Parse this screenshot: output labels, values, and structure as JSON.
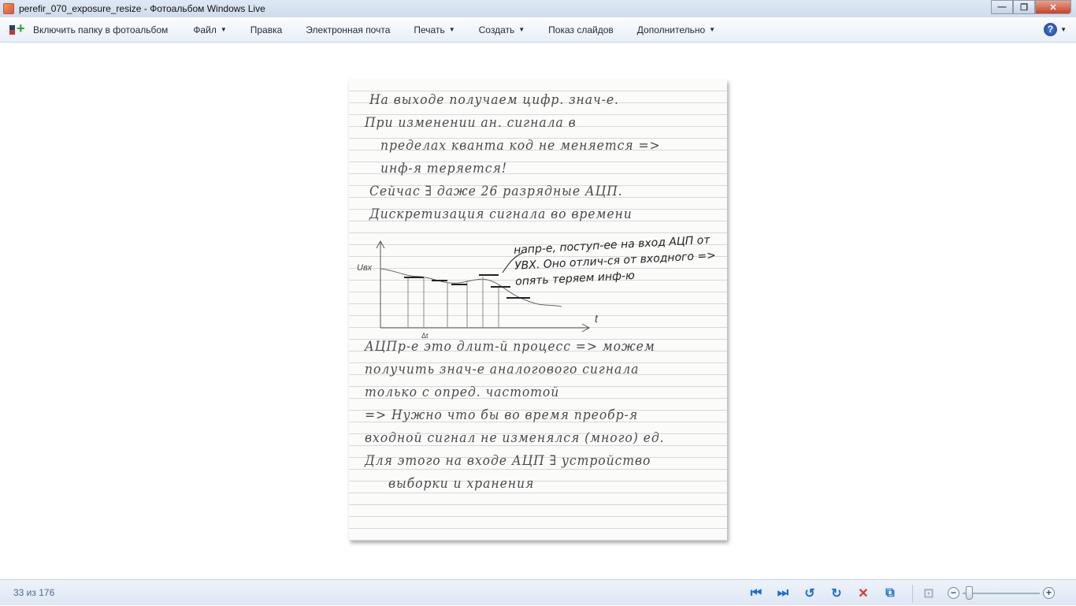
{
  "window": {
    "title": "perefir_070_exposure_resize - Фотоальбом Windows Live",
    "minimize": "—",
    "maximize": "❐",
    "close": "✕"
  },
  "toolbar": {
    "include_folder": "Включить папку в фотоальбом",
    "file": "Файл",
    "edit": "Правка",
    "email": "Электронная почта",
    "print": "Печать",
    "create": "Создать",
    "slideshow": "Показ слайдов",
    "more": "Дополнительно",
    "help": "?"
  },
  "photo": {
    "lines_top": [
      "На выходе получаем цифр. знач-е.",
      "При изменении ан. сигнала в",
      "пределах кванта код не меняется =>",
      "инф-я теряется!",
      "Сейчас ∃ даже 26 разрядные АЦП.",
      "",
      "Дискретизация сигнала во времени"
    ],
    "graph_note": "напр-е, поступ-ее на вход АЦП от УВХ. Оно отлич-ся от входного => опять теряем инф-ю",
    "graph_labels": {
      "y": "Uвх",
      "x": "t",
      "dt": "Δt"
    },
    "lines_bottom": [
      "АЦПр-е это длит-й процесс => можем",
      "получить знач-е аналогового сигнала",
      "только с опред. частотой",
      "=> Нужно что бы во время преобр-я",
      "входной сигнал не изменялся (много) ед.",
      "Для этого на входе АЦП ∃ устройство",
      "выборки и хранения"
    ]
  },
  "status": {
    "count": "33 из 176"
  },
  "zoom": {
    "level": 0.05
  }
}
